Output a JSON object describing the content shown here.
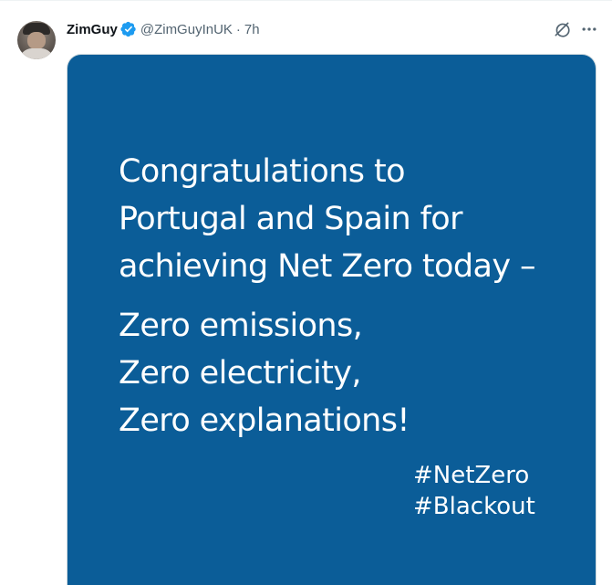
{
  "tweet": {
    "author": {
      "display_name": "ZimGuy",
      "handle": "@ZimGuyInUK",
      "separator": "·",
      "time": "7h",
      "verified_icon": "verified-badge-icon"
    },
    "actions": {
      "grok_icon": "grok-icon",
      "more_icon": "more-options-icon"
    },
    "media": {
      "background_color": "#0b5d98",
      "text_color": "#ffffff",
      "lines_intro": [
        "Congratulations to",
        "Portugal and Spain for",
        "achieving Net Zero today –"
      ],
      "lines_zero": [
        "Zero emissions,",
        "Zero electricity,",
        "Zero explanations!"
      ],
      "hashtags": [
        "#NetZero",
        "#Blackout"
      ]
    }
  }
}
